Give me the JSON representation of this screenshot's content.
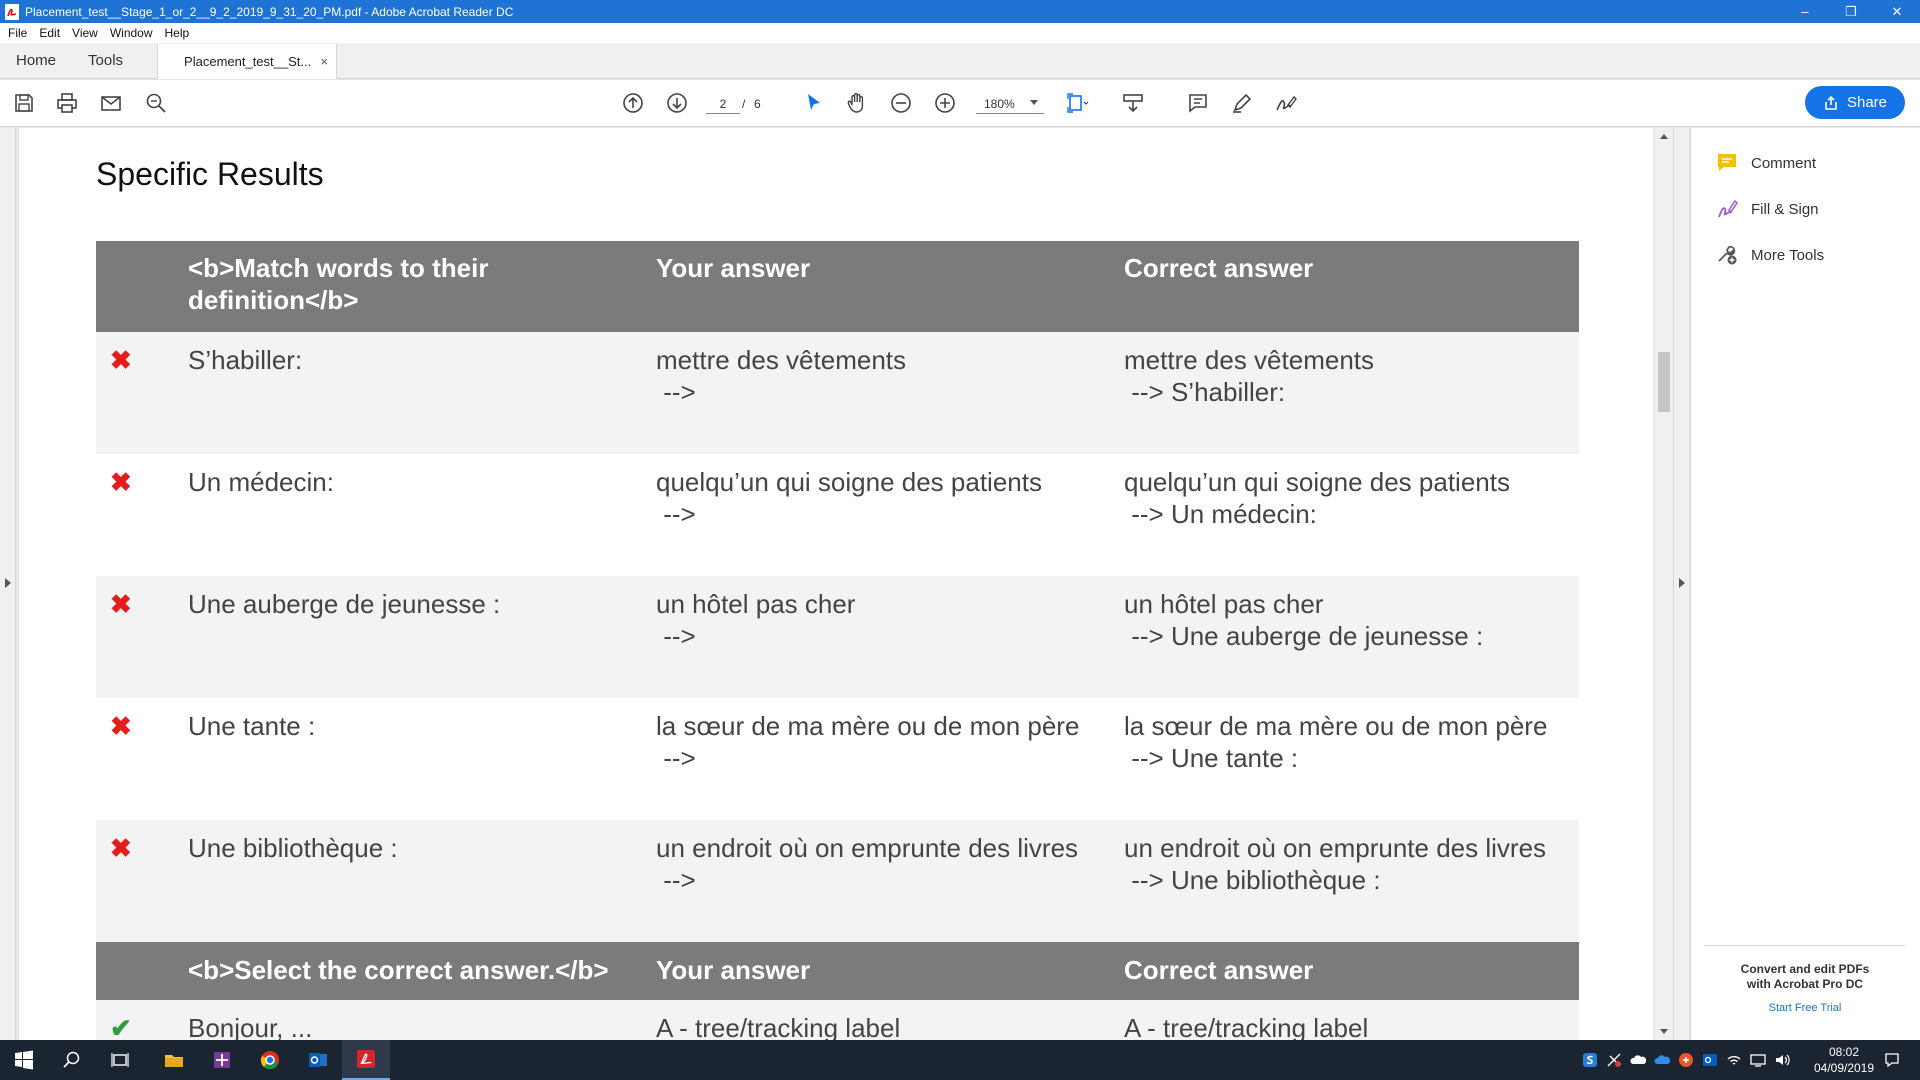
{
  "window": {
    "title": "Placement_test__Stage_1_or_2__9_2_2019_9_31_20_PM.pdf - Adobe Acrobat Reader DC",
    "minimize": "–",
    "restore": "❐",
    "close": "✕"
  },
  "menu": [
    "File",
    "Edit",
    "View",
    "Window",
    "Help"
  ],
  "tabs": {
    "home": "Home",
    "tools": "Tools",
    "document": "Placement_test__St...",
    "close": "×"
  },
  "toolbar": {
    "page_current": "2",
    "page_separator": "/",
    "page_total": "6",
    "zoom": "180%",
    "share_label": "Share"
  },
  "document": {
    "heading": "Specific Results",
    "sections": [
      {
        "header": {
          "question": "<b>Match words to their definition</b>",
          "your_answer": "Your answer",
          "correct_answer": "Correct answer"
        },
        "rows": [
          {
            "status": "incorrect",
            "mark": "✖",
            "question": "S’habiller:",
            "your_answer_line1": "mettre des vêtements",
            "your_answer_line2": " -->",
            "correct_line1": "mettre des vêtements",
            "correct_line2": " --> S’habiller:"
          },
          {
            "status": "incorrect",
            "mark": "✖",
            "question": "Un médecin:",
            "your_answer_line1": "quelqu’un qui soigne des patients",
            "your_answer_line2": " -->",
            "correct_line1": "quelqu’un qui soigne des patients",
            "correct_line2": " --> Un médecin:"
          },
          {
            "status": "incorrect",
            "mark": "✖",
            "question": "Une auberge de jeunesse :",
            "your_answer_line1": "un hôtel pas cher",
            "your_answer_line2": " -->",
            "correct_line1": "un hôtel pas cher",
            "correct_line2": " --> Une auberge de jeunesse :"
          },
          {
            "status": "incorrect",
            "mark": "✖",
            "question": "Une tante :",
            "your_answer_line1": "la sœur de ma mère ou de mon père",
            "your_answer_line2": " -->",
            "correct_line1": "la sœur de ma mère ou de mon père",
            "correct_line2": " --> Une tante :"
          },
          {
            "status": "incorrect",
            "mark": "✖",
            "question": "Une bibliothèque :",
            "your_answer_line1": "un endroit où on emprunte des livres",
            "your_answer_line2": " -->",
            "correct_line1": "un endroit où on emprunte des livres",
            "correct_line2": " --> Une bibliothèque :"
          }
        ]
      },
      {
        "header": {
          "question": "<b>Select the correct answer.</b>",
          "your_answer": "Your answer",
          "correct_answer": "Correct answer"
        },
        "rows": [
          {
            "status": "correct",
            "mark": "✔",
            "question": "Bonjour, ...",
            "your_answer_line1": "A - tree/tracking label",
            "correct_line1": "A - tree/tracking label"
          }
        ]
      }
    ]
  },
  "right_panel": {
    "tools": [
      "Comment",
      "Fill & Sign",
      "More Tools"
    ],
    "promo_title_line1": "Convert and edit PDFs",
    "promo_title_line2": "with Acrobat Pro DC",
    "promo_link": "Start Free Trial"
  },
  "taskbar": {
    "time": "08:02",
    "date": "04/09/2019"
  },
  "colors": {
    "titlebar": "#1e73d4",
    "accent": "#1473e6",
    "table_header": "#7b7b7b",
    "incorrect_mark": "#e41c1c",
    "correct_mark": "#2d9e3b",
    "taskbar": "#1b2431"
  }
}
